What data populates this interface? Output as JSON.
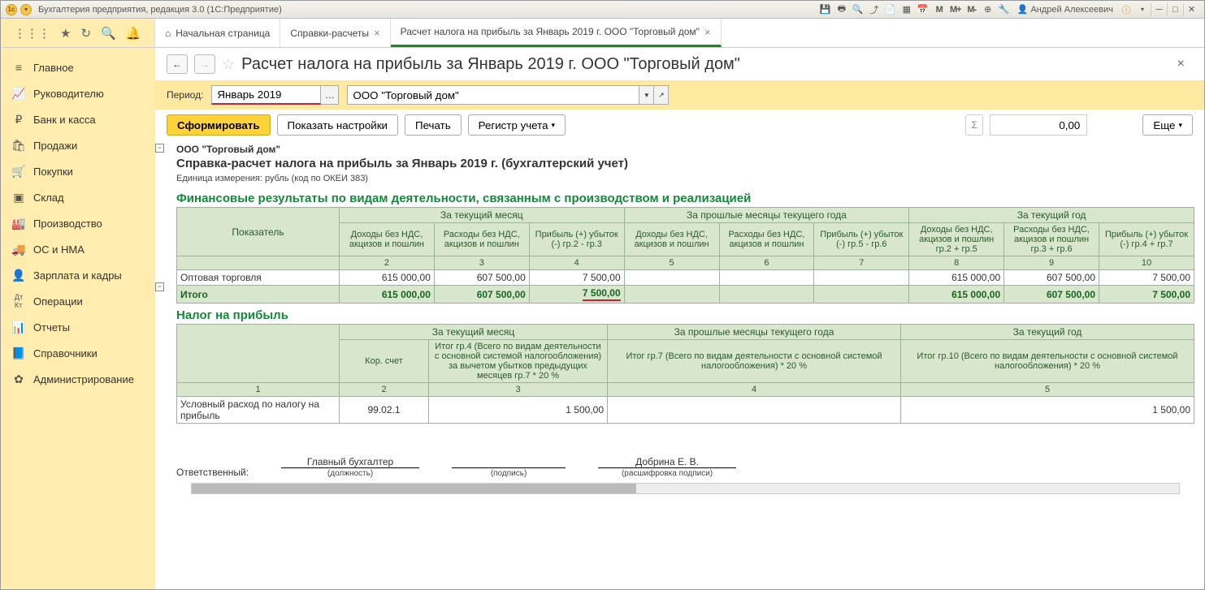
{
  "titlebar": {
    "app_title": "Бухгалтерия предприятия, редакция 3.0  (1С:Предприятие)",
    "user_name": "Андрей Алексеевич",
    "m_labels": [
      "M",
      "M+",
      "M-"
    ]
  },
  "toolbar_tabs": {
    "home": "Начальная страница",
    "tab1": "Справки-расчеты",
    "tab2": "Расчет налога на прибыль за Январь 2019 г. ООО \"Торговый дом\""
  },
  "sidebar": {
    "items": [
      {
        "icon": "≡",
        "label": "Главное"
      },
      {
        "icon": "📈",
        "label": "Руководителю"
      },
      {
        "icon": "₽",
        "label": "Банк и касса"
      },
      {
        "icon": "🛍",
        "label": "Продажи"
      },
      {
        "icon": "🛒",
        "label": "Покупки"
      },
      {
        "icon": "🏭",
        "label": "Склад"
      },
      {
        "icon": "🏢",
        "label": "Производство"
      },
      {
        "icon": "🚚",
        "label": "ОС и НМА"
      },
      {
        "icon": "👤",
        "label": "Зарплата и кадры"
      },
      {
        "icon": "Дт",
        "label": "Операции"
      },
      {
        "icon": "📊",
        "label": "Отчеты"
      },
      {
        "icon": "📘",
        "label": "Справочники"
      },
      {
        "icon": "✿",
        "label": "Администрирование"
      }
    ]
  },
  "page": {
    "title": "Расчет налога на прибыль за Январь 2019 г. ООО \"Торговый дом\"",
    "period_label": "Период:",
    "period_value": "Январь 2019",
    "org_value": "ООО \"Торговый дом\"",
    "buttons": {
      "form": "Сформировать",
      "show_settings": "Показать настройки",
      "print": "Печать",
      "register": "Регистр учета",
      "more": "Еще"
    },
    "sum_sigma": "Σ",
    "sum_value": "0,00"
  },
  "report": {
    "org": "ООО \"Торговый дом\"",
    "title": "Справка-расчет налога на прибыль за Январь 2019 г. (бухгалтерский учет)",
    "unit": "Единица измерения:   рубль (код по ОКЕИ 383)",
    "section1": {
      "title": "Финансовые результаты по видам деятельности, связанным с производством и реализацией",
      "col_indicator": "Показатель",
      "group_cur_month": "За текущий месяц",
      "group_prev_months": "За прошлые месяцы текущего года",
      "group_cur_year": "За текущий год",
      "h_income": "Доходы без НДС, акцизов и пошлин",
      "h_expense": "Расходы без НДС, акцизов и пошлин",
      "h_profit_a": "Прибыль (+) убыток (-) гр.2 - гр.3",
      "h_profit_b": "Прибыль (+) убыток (-) гр.5 - гр.6",
      "h_income_y": "Доходы без НДС, акцизов и пошлин гр.2 + гр.5",
      "h_expense_y": "Расходы без НДС, акцизов и пошлин гр.3 + гр.6",
      "h_profit_y": "Прибыль (+) убыток (-) гр.4 + гр.7",
      "nums": [
        "2",
        "3",
        "4",
        "5",
        "6",
        "7",
        "8",
        "9",
        "10"
      ],
      "row_label": "Оптовая торговля",
      "row": [
        "615 000,00",
        "607 500,00",
        "7 500,00",
        "",
        "",
        "",
        "615 000,00",
        "607 500,00",
        "7 500,00"
      ],
      "total_label": "Итого",
      "total": [
        "615 000,00",
        "607 500,00",
        "7 500,00",
        "",
        "",
        "",
        "615 000,00",
        "607 500,00",
        "7 500,00"
      ]
    },
    "section2": {
      "title": "Налог на прибыль",
      "group_cur_month": "За текущий месяц",
      "group_prev_months": "За прошлые месяцы текущего года",
      "group_cur_year": "За текущий год",
      "h_empty": "",
      "h_acc": "Кор. счет",
      "h_c3": "Итог гр.4 (Всего по видам деятельности с основной системой налогообложения) за вычетом убытков предыдущих месяцев гр.7 * 20 %",
      "h_c4": "Итог гр.7 (Всего по видам деятельности с основной системой налогообложения) * 20 %",
      "h_c5": "Итог гр.10 (Всего по видам деятельности с основной системой налогообложения) * 20 %",
      "nums": [
        "1",
        "2",
        "3",
        "4",
        "5"
      ],
      "row_label": "Условный расход по налогу на прибыль",
      "row": [
        "99.02.1",
        "1 500,00",
        "",
        "1 500,00"
      ]
    },
    "sign": {
      "resp": "Ответственный:",
      "pos_value": "Главный бухгалтер",
      "pos": "(должность)",
      "sig": "(подпись)",
      "name_value": "Добрина Е. В.",
      "name": "(расшифровка подписи)"
    }
  }
}
